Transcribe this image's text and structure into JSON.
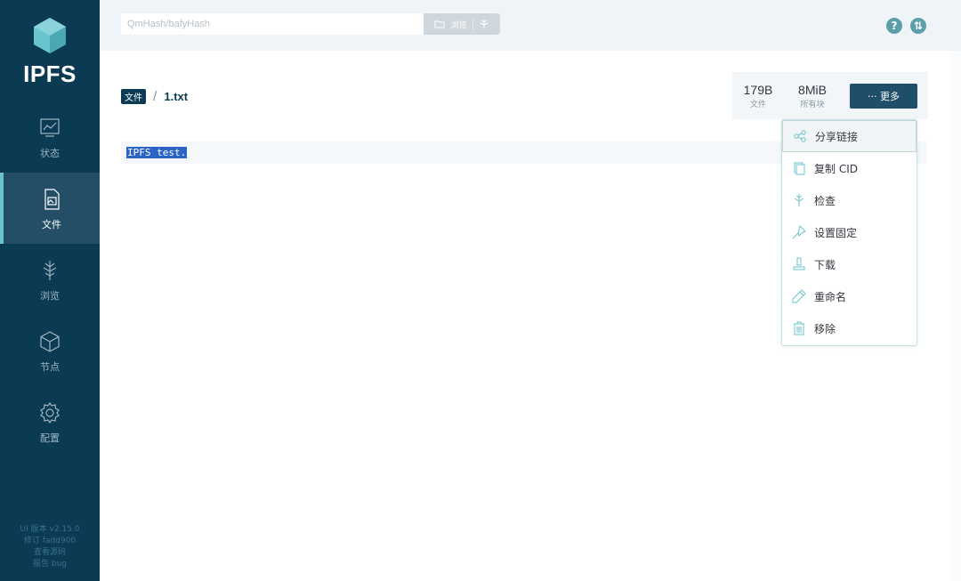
{
  "app": {
    "logo_text": "IPFS"
  },
  "sidebar": {
    "items": [
      {
        "label": "状态",
        "icon": "status-icon"
      },
      {
        "label": "文件",
        "icon": "files-icon",
        "active": true
      },
      {
        "label": "浏览",
        "icon": "explore-icon"
      },
      {
        "label": "节点",
        "icon": "peers-icon"
      },
      {
        "label": "配置",
        "icon": "settings-icon"
      }
    ],
    "version": {
      "ui_version": "UI 版本 v2.15.0",
      "revision": "修订 fadd900",
      "source": "查看源码",
      "report": "报告 bug"
    }
  },
  "topbar": {
    "search_placeholder": "QmHash/bafyHash",
    "browse_label": "浏览"
  },
  "breadcrumb": {
    "root": "文件",
    "separator": "/",
    "file": "1.txt"
  },
  "stats": {
    "file_size": "179B",
    "file_size_caption": "文件",
    "all_blocks": "8MiB",
    "all_blocks_caption": "所有块",
    "more_label": "··· 更多"
  },
  "file_content": "IPFS test.",
  "dropdown": {
    "items": [
      {
        "label": "分享链接",
        "icon": "share-icon"
      },
      {
        "label": "复制 CID",
        "icon": "copy-icon"
      },
      {
        "label": "检查",
        "icon": "inspect-icon"
      },
      {
        "label": "设置固定",
        "icon": "pin-icon"
      },
      {
        "label": "下载",
        "icon": "download-icon"
      },
      {
        "label": "重命名",
        "icon": "rename-icon"
      },
      {
        "label": "移除",
        "icon": "trash-icon"
      }
    ]
  },
  "colors": {
    "sidebar": "#0b3a53",
    "accent": "#69c4cd",
    "button": "#1f4e68"
  }
}
